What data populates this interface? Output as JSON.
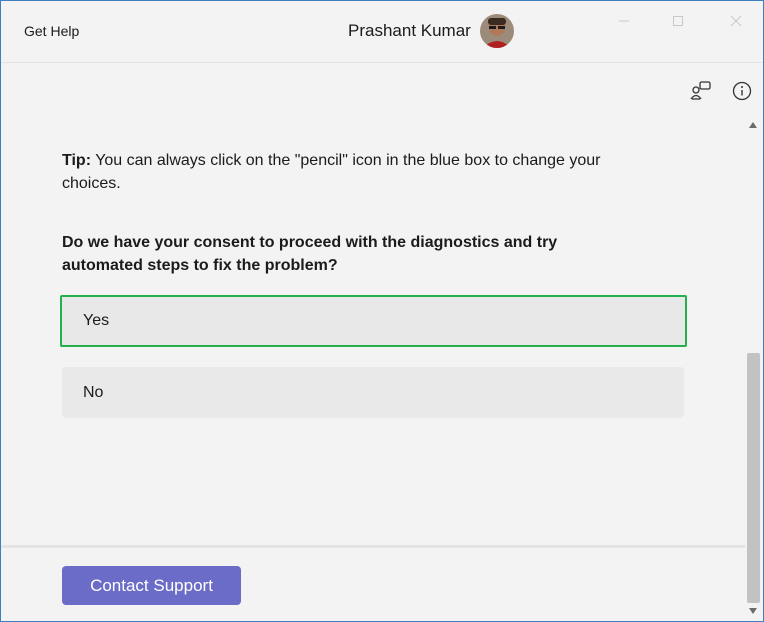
{
  "app": {
    "title": "Get Help",
    "user_name": "Prashant Kumar"
  },
  "window_controls": {
    "minimize_icon": "minimize-icon",
    "maximize_icon": "maximize-icon",
    "close_icon": "close-icon"
  },
  "toolbar": {
    "chat_icon": "chat-icon",
    "info_icon": "info-icon"
  },
  "content": {
    "tip_label": "Tip:",
    "tip_text": " You can always click on the \"pencil\" icon in the blue box to change your choices.",
    "question": "Do we have your consent to proceed with the diagnostics and try automated steps to fix the problem?",
    "options": [
      {
        "label": "Yes",
        "selected": true
      },
      {
        "label": "No",
        "selected": false
      }
    ]
  },
  "footer": {
    "contact_label": "Contact Support"
  },
  "colors": {
    "accent_button": "#6b6bc8",
    "selected_outline": "#22b14c",
    "window_border": "#3f7fc0"
  }
}
